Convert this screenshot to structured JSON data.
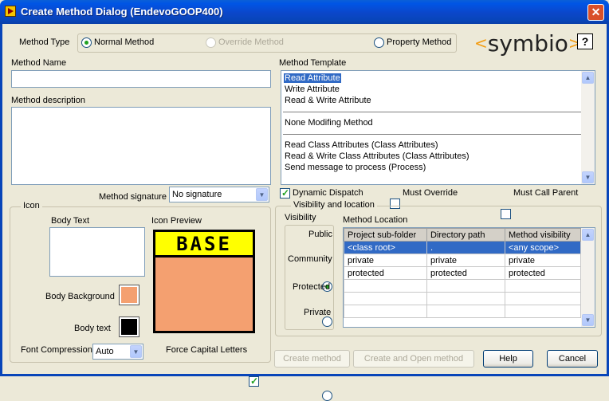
{
  "window": {
    "title": "Create Method Dialog (EndevoGOOP400)"
  },
  "logo": {
    "text": "symbio",
    "left": "<",
    "right": ">"
  },
  "help_icon": "?",
  "method_type": {
    "label": "Method Type",
    "options": [
      "Normal Method",
      "Override Method",
      "Property Method"
    ],
    "selected": "Normal Method"
  },
  "method_name": {
    "label": "Method Name",
    "value": ""
  },
  "method_description": {
    "label": "Method description",
    "value": ""
  },
  "method_signature": {
    "label": "Method signature",
    "value": "No signature"
  },
  "method_template": {
    "label": "Method Template",
    "groups": [
      [
        "Read Attribute",
        "Write Attribute",
        "Read & Write Attribute"
      ],
      [
        "None Modifing Method"
      ],
      [
        "Read Class Attributes (Class Attributes)",
        "Read & Write Class Attributes (Class Attributes)",
        "Send message to process (Process)"
      ]
    ],
    "selected": "Read Attribute"
  },
  "checks": {
    "dynamic_dispatch": {
      "label": "Dynamic Dispatch",
      "checked": true
    },
    "must_override": {
      "label": "Must Override",
      "checked": false
    },
    "must_call_parent": {
      "label": "Must Call Parent",
      "checked": false
    }
  },
  "icon_group": {
    "label": "Icon",
    "body_text_label": "Body Text",
    "body_text_value": "",
    "icon_preview_label": "Icon Preview",
    "banner_text": "BASE",
    "body_background_label": "Body Background",
    "body_background_color": "#f4a070",
    "body_text_color_label": "Body text",
    "body_text_color": "#000000",
    "banner_color": "#ffff00",
    "font_compression_label": "Font Compression",
    "font_compression_value": "Auto",
    "force_capital_label": "Force Capital Letters",
    "force_capital_checked": true
  },
  "visibility_location": {
    "label": "Visibility and location",
    "visibility_label": "Visibility",
    "visibility_options": [
      "Public",
      "Community",
      "Protected",
      "Private"
    ],
    "visibility_selected": "Public",
    "method_location_label": "Method Location",
    "columns": [
      "Project sub-folder",
      "Directory path",
      "Method visibility"
    ],
    "rows": [
      [
        "<class root>",
        ".",
        "<any scope>"
      ],
      [
        "private",
        "private",
        "private"
      ],
      [
        "protected",
        "protected",
        "protected"
      ],
      [
        "",
        "",
        ""
      ],
      [
        "",
        "",
        ""
      ],
      [
        "",
        "",
        ""
      ]
    ],
    "selected_row": 0
  },
  "buttons": {
    "create_method": "Create method",
    "create_and_open": "Create and Open method",
    "help": "Help",
    "cancel": "Cancel"
  },
  "colors": {
    "titlebar": "#0845b9",
    "dialog_bg": "#ece9d8",
    "selection": "#316ac5",
    "logo_accent": "#f39c12"
  }
}
